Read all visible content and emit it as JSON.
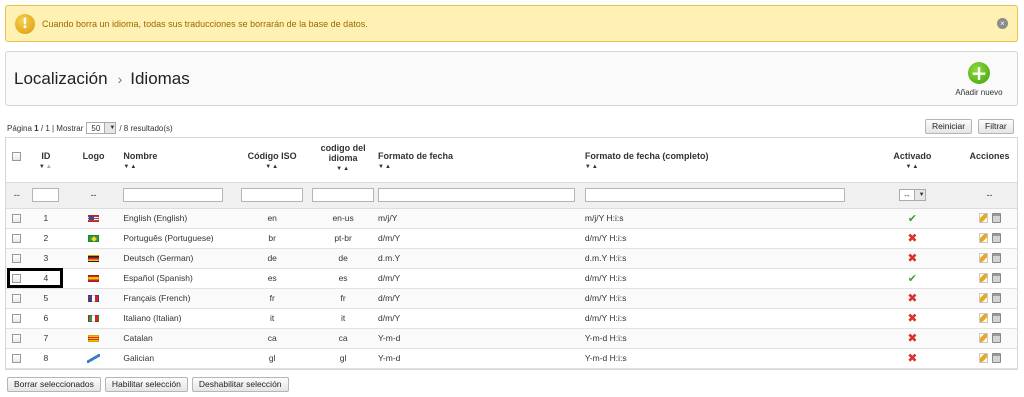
{
  "warning": {
    "icon": "warning-icon",
    "text": "Cuando borra un idioma, todas sus traducciones se borrarán de la base de datos.",
    "close_icon": "close-icon"
  },
  "header": {
    "breadcrumb_root": "Localización",
    "separator": "›",
    "breadcrumb_current": "Idiomas",
    "add_button_label": "Añadir nuevo"
  },
  "pager": {
    "prefix": "Página",
    "current": "1",
    "sep": "/",
    "total": "1",
    "show_label": "| Mostrar",
    "per_page": "50",
    "results": "/ 8 resultado(s)"
  },
  "buttons": {
    "reset": "Reiniciar",
    "filter": "Filtrar",
    "delete_selected": "Borrar seleccionados",
    "enable_selected": "Habilitar selección",
    "disable_selected": "Deshabilitar selección"
  },
  "columns": {
    "id": "ID",
    "logo": "Logo",
    "name": "Nombre",
    "iso": "Código ISO",
    "lang_code_1": "codigo del",
    "lang_code_2": "idioma",
    "date_format": "Formato de fecha",
    "date_format_full": "Formato de fecha (completo)",
    "active": "Activado",
    "actions": "Acciones"
  },
  "filter_row": {
    "dash": "--",
    "active_select": "--"
  },
  "rows": [
    {
      "id": "1",
      "flag": "flag-us",
      "name": "English (English)",
      "iso": "en",
      "code": "en-us",
      "date": "m/j/Y",
      "date_full": "m/j/Y H:i:s",
      "active": true
    },
    {
      "id": "2",
      "flag": "flag-br",
      "name": "Português (Portuguese)",
      "iso": "br",
      "code": "pt-br",
      "date": "d/m/Y",
      "date_full": "d/m/Y H:i:s",
      "active": false
    },
    {
      "id": "3",
      "flag": "flag-de",
      "name": "Deutsch (German)",
      "iso": "de",
      "code": "de",
      "date": "d.m.Y",
      "date_full": "d.m.Y H:i:s",
      "active": false
    },
    {
      "id": "4",
      "flag": "flag-es",
      "name": "Español (Spanish)",
      "iso": "es",
      "code": "es",
      "date": "d/m/Y",
      "date_full": "d/m/Y H:i:s",
      "active": true
    },
    {
      "id": "5",
      "flag": "flag-fr",
      "name": "Français (French)",
      "iso": "fr",
      "code": "fr",
      "date": "d/m/Y",
      "date_full": "d/m/Y H:i:s",
      "active": false
    },
    {
      "id": "6",
      "flag": "flag-it",
      "name": "Italiano (Italian)",
      "iso": "it",
      "code": "it",
      "date": "d/m/Y",
      "date_full": "d/m/Y H:i:s",
      "active": false
    },
    {
      "id": "7",
      "flag": "flag-ca",
      "name": "Catalan",
      "iso": "ca",
      "code": "ca",
      "date": "Y-m-d",
      "date_full": "Y-m-d H:i:s",
      "active": false
    },
    {
      "id": "8",
      "flag": "flag-gl",
      "name": "Galician",
      "iso": "gl",
      "code": "gl",
      "date": "Y-m-d",
      "date_full": "Y-m-d H:i:s",
      "active": false
    }
  ],
  "status_symbols": {
    "yes": "✔",
    "no": "✖"
  },
  "colors": {
    "warning_bg": "#fff0b3",
    "warning_text": "#9a6a00",
    "active": "#3aa33a",
    "inactive": "#d9322a"
  }
}
